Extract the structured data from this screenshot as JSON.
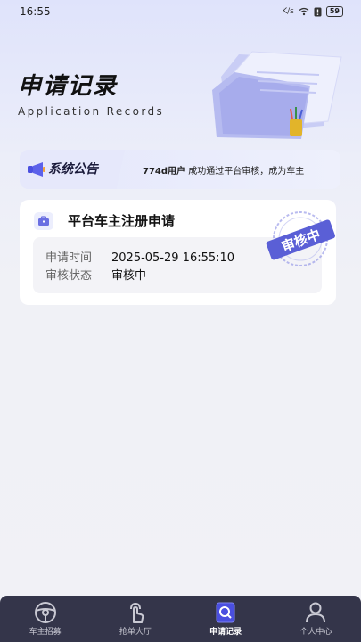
{
  "status_bar": {
    "time": "16:55",
    "network_label": "K/s",
    "battery": "59"
  },
  "header": {
    "title": "申请记录",
    "subtitle": "Application Records"
  },
  "announcement": {
    "label": "系统公告",
    "user": "774d用户",
    "message": "成功通过平台审核，成为车主"
  },
  "application": {
    "title": "平台车主注册申请",
    "stamp_text": "审核中",
    "rows": [
      {
        "label": "申请时间",
        "value": "2025-05-29 16:55:10"
      },
      {
        "label": "审核状态",
        "value": "审核中"
      }
    ]
  },
  "tabbar": {
    "items": [
      {
        "label": "车主招募",
        "icon": "steering-wheel-icon",
        "active": false
      },
      {
        "label": "抢单大厅",
        "icon": "tap-hand-icon",
        "active": false
      },
      {
        "label": "申请记录",
        "icon": "search-doc-icon",
        "active": true
      },
      {
        "label": "个人中心",
        "icon": "person-icon",
        "active": false
      }
    ]
  },
  "colors": {
    "accent": "#4a4fe0",
    "tabbar_bg": "#34354a",
    "stamp": "#5a5fd6"
  }
}
